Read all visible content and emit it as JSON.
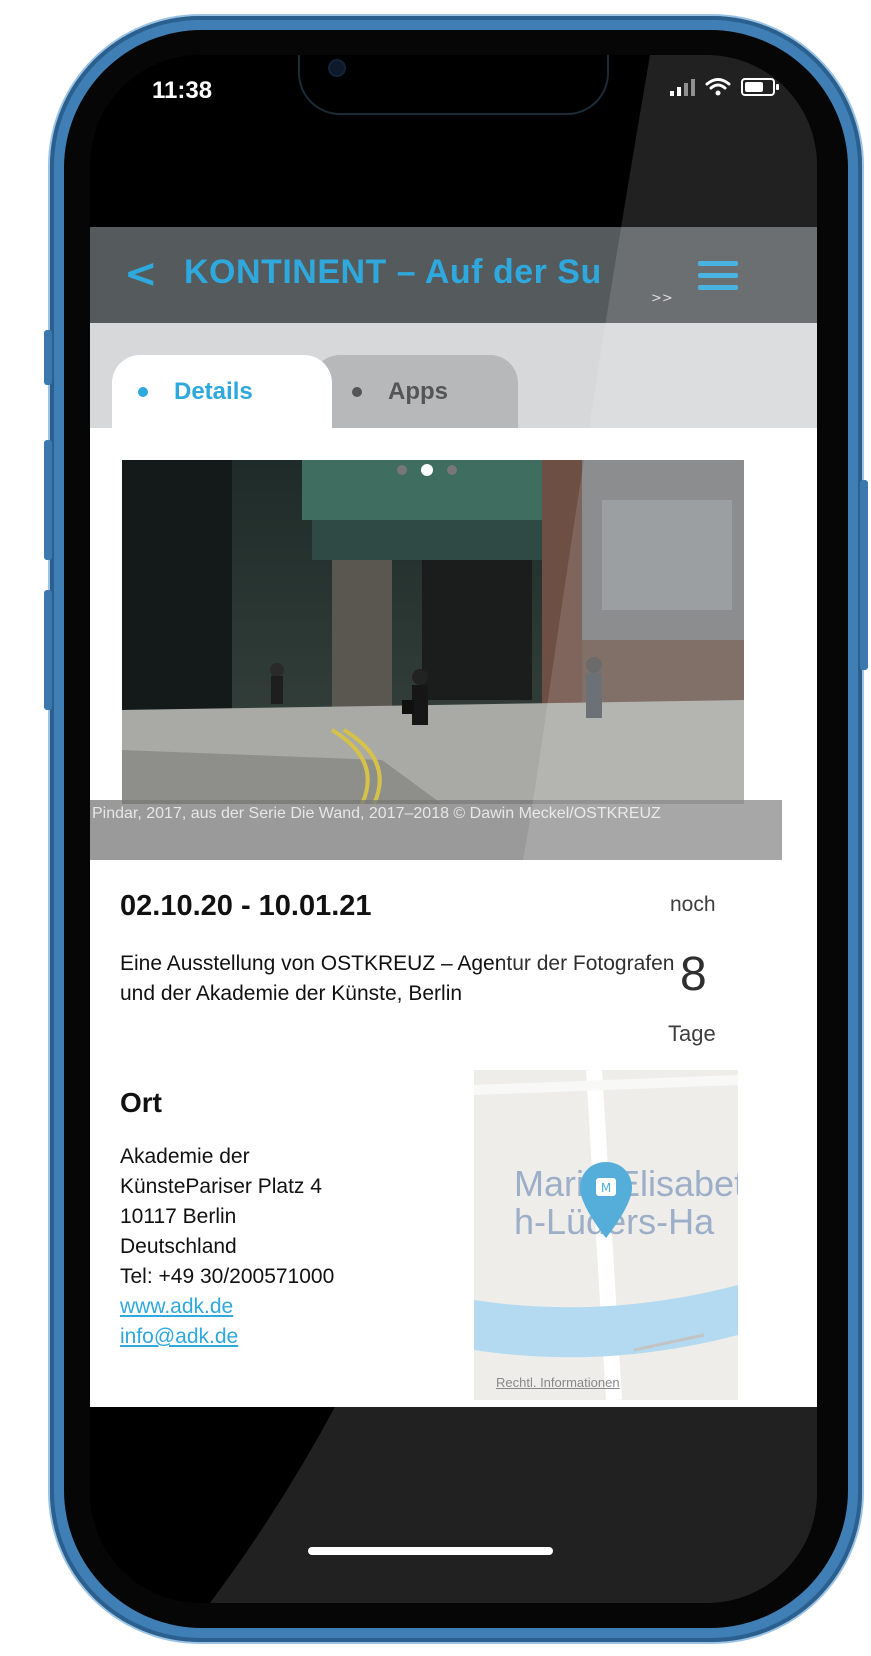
{
  "status": {
    "time": "11:38"
  },
  "header": {
    "back_label": "<",
    "title": "KONTINENT – Auf der Su",
    "more_label": ">>"
  },
  "tabs": [
    {
      "label": "Details",
      "active": true
    },
    {
      "label": "Apps",
      "active": false
    }
  ],
  "photo": {
    "caption": "Pindar, 2017, aus der Serie Die Wand, 2017–2018 © Dawin Meckel/OSTKREUZ"
  },
  "exhibition": {
    "dates": "02.10.20 - 10.01.21",
    "countdown_prefix": "noch",
    "countdown_days": "8",
    "countdown_unit": "Tage",
    "description": "Eine Ausstellung von OSTKREUZ – Agentur der Fotografen und der Akademie der Künste, Berlin"
  },
  "location": {
    "heading": "Ort",
    "address_line1": "Akademie der",
    "address_line2": "KünstePariser Platz 4",
    "address_line3": "10117 Berlin",
    "address_line4": "Deutschland",
    "phone": "Tel: +49 30/200571000",
    "website": "www.adk.de",
    "email": "info@adk.de"
  },
  "map": {
    "place_label": "Marie-Elisabeth-Lüders-Ha",
    "legal_label": "Rechtl. Informationen",
    "pin_label": "M"
  },
  "colors": {
    "accent": "#2ea8dd",
    "frame": "#3f7fb5",
    "titlebar": "#555a5d"
  }
}
